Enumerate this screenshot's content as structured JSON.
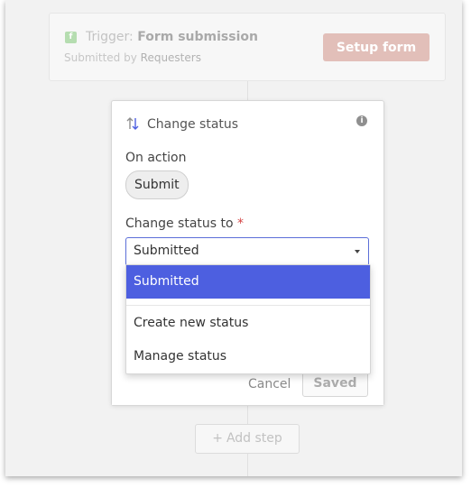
{
  "trigger": {
    "prefix": "Trigger:",
    "name": "Form submission",
    "sub_prefix": "Submitted by",
    "sub_value": "Requesters",
    "setup_label": "Setup form",
    "icon": "form-icon"
  },
  "modal": {
    "title": "Change status",
    "title_icon": "sort-arrows-icon",
    "info_icon": "info-icon",
    "on_action_label": "On action",
    "action_chip": "Submit",
    "status_label": "Change status to",
    "required_mark": "*",
    "selected_value": "Submitted",
    "cancel_label": "Cancel",
    "saved_label": "Saved"
  },
  "dropdown": {
    "options": [
      "Submitted"
    ],
    "create_label": "Create new status",
    "manage_label": "Manage status"
  },
  "add_step": {
    "label": "Add step",
    "icon": "+"
  },
  "colors": {
    "accent": "#4d5fe0",
    "setup_button": "#e2bfb9",
    "required": "#d34343"
  }
}
